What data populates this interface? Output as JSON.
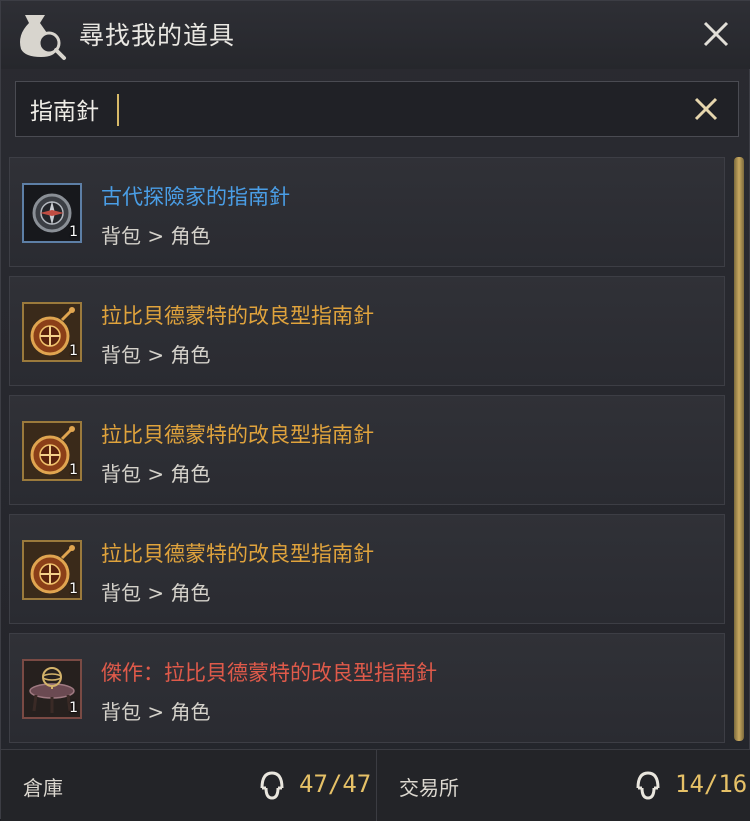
{
  "window": {
    "title": "尋找我的道具"
  },
  "search": {
    "value": "指南針"
  },
  "items": [
    {
      "name": "古代探險家的指南針",
      "path": "背包 > 角色",
      "qty": "1",
      "color": "#4a9ee6",
      "icon": "ancient-compass-icon"
    },
    {
      "name": "拉比貝德蒙特的改良型指南針",
      "path": "背包 > 角色",
      "qty": "1",
      "color": "#e0a33c",
      "icon": "pocket-compass-icon"
    },
    {
      "name": "拉比貝德蒙特的改良型指南針",
      "path": "背包 > 角色",
      "qty": "1",
      "color": "#e0a33c",
      "icon": "pocket-compass-icon"
    },
    {
      "name": "拉比貝德蒙特的改良型指南針",
      "path": "背包 > 角色",
      "qty": "1",
      "color": "#e0a33c",
      "icon": "pocket-compass-icon"
    },
    {
      "name": "傑作：拉比貝德蒙特的改良型指南針",
      "path": "背包 > 角色",
      "qty": "1",
      "color": "#e05a4a",
      "icon": "armillary-table-icon"
    }
  ],
  "footer": {
    "warehouse_label": "倉庫",
    "warehouse_value": "47/47",
    "exchange_label": "交易所",
    "exchange_value": "14/16"
  },
  "colors": {
    "accent": "#e6c167",
    "blue_rarity": "#4a9ee6",
    "gold_rarity": "#e0a33c",
    "red_rarity": "#e05a4a"
  }
}
